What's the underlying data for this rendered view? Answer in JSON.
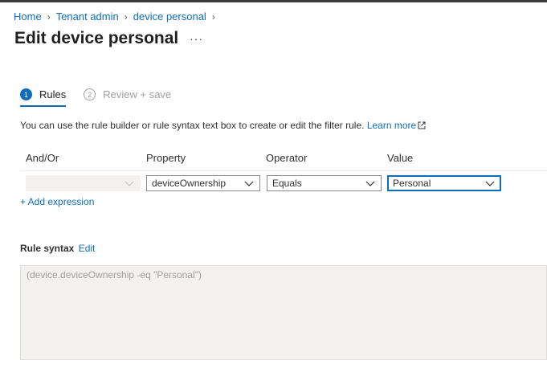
{
  "breadcrumb": [
    "Home",
    "Tenant admin",
    "device personal"
  ],
  "page": {
    "title": "Edit device personal",
    "more_label": "···"
  },
  "steps": [
    {
      "number": "1",
      "label": "Rules"
    },
    {
      "number": "2",
      "label": "Review + save"
    }
  ],
  "description": {
    "text": "You can use the rule builder or rule syntax text box to create or edit the filter rule.",
    "link": "Learn more"
  },
  "table": {
    "headers": [
      "And/Or",
      "Property",
      "Operator",
      "Value"
    ],
    "row": {
      "and_or": "",
      "property": "deviceOwnership",
      "operator": "Equals",
      "value": "Personal"
    }
  },
  "add_expression": "+ Add expression",
  "rule_syntax": {
    "label": "Rule syntax",
    "edit_link": "Edit",
    "value": "(device.deviceOwnership -eq \"Personal\")"
  },
  "colors": {
    "accent": "#0f6cbd",
    "disabled_bg": "#f3f2f1"
  }
}
